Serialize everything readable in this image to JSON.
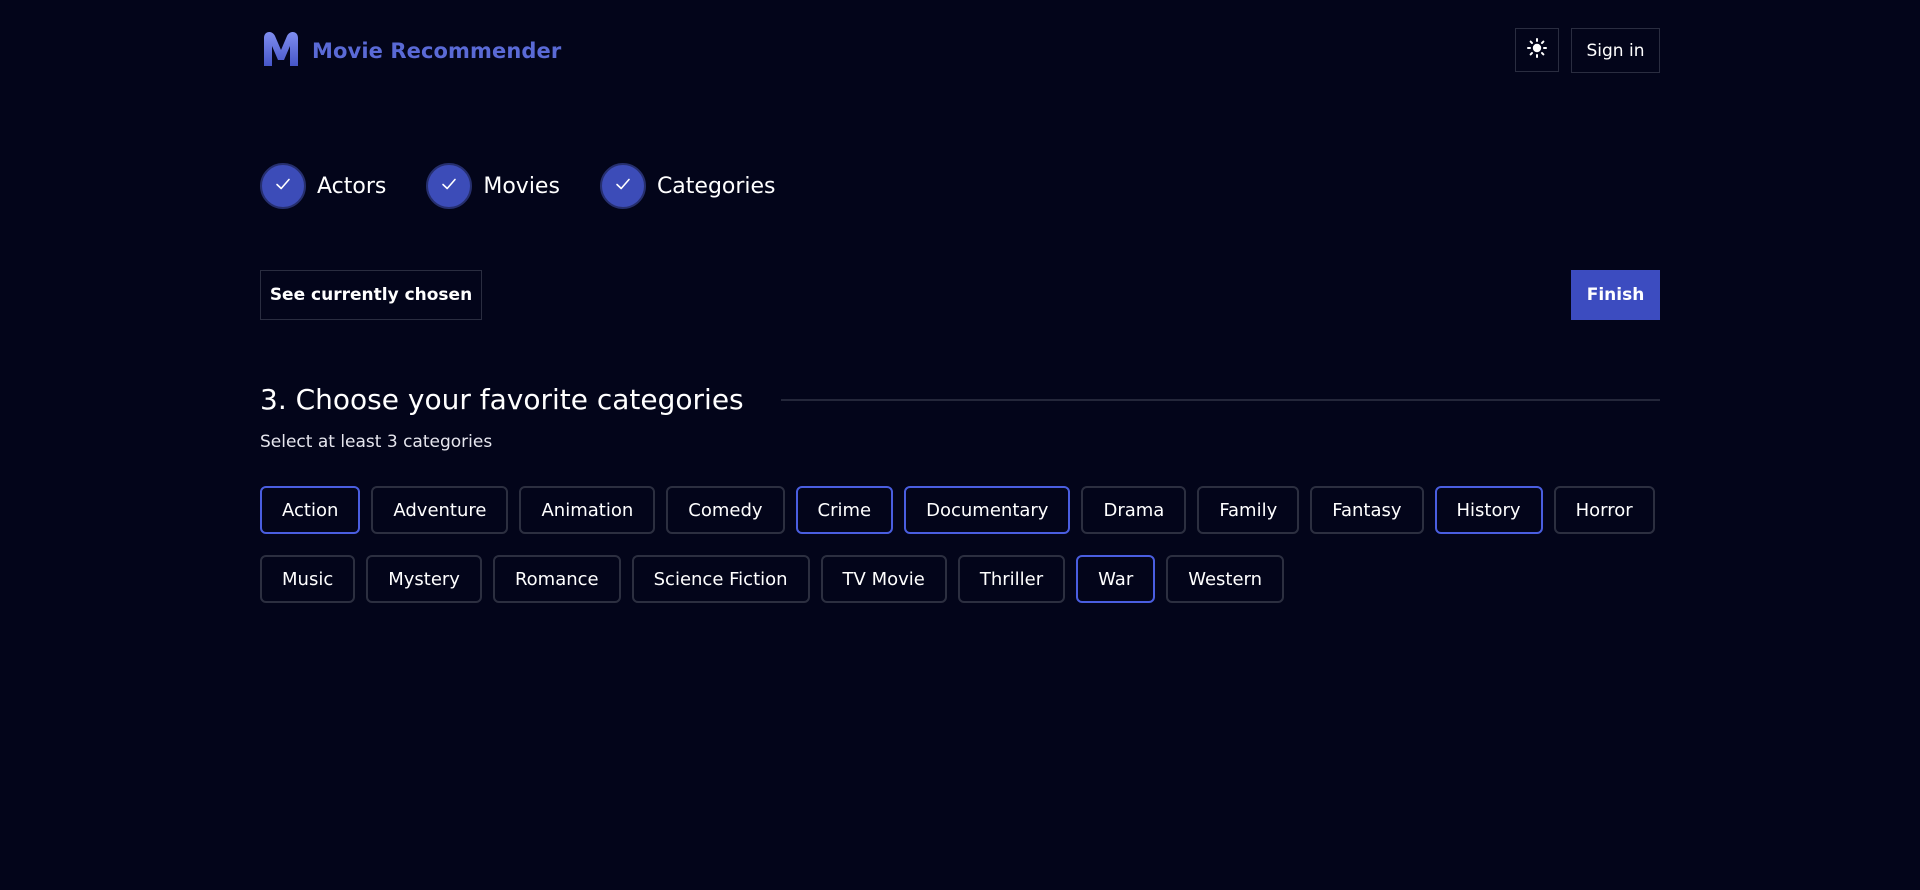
{
  "header": {
    "brand_title": "Movie Recommender",
    "sign_in_label": "Sign in",
    "theme_icon": "sun-icon"
  },
  "colors": {
    "background": "#03051a",
    "accent": "#3c4cc0",
    "brand_text": "#5a6ad6",
    "selected_border": "#4a5ee0",
    "chip_border": "#2c2f40"
  },
  "steps": [
    {
      "label": "Actors",
      "completed": true
    },
    {
      "label": "Movies",
      "completed": true
    },
    {
      "label": "Categories",
      "completed": true
    }
  ],
  "actions": {
    "see_chosen_label": "See currently chosen",
    "finish_label": "Finish"
  },
  "section": {
    "title": "3. Choose your favorite categories",
    "subtitle": "Select at least 3 categories"
  },
  "categories": {
    "row1": [
      {
        "label": "Action",
        "selected": true
      },
      {
        "label": "Adventure",
        "selected": false
      },
      {
        "label": "Animation",
        "selected": false
      },
      {
        "label": "Comedy",
        "selected": false
      },
      {
        "label": "Crime",
        "selected": true
      },
      {
        "label": "Documentary",
        "selected": true
      },
      {
        "label": "Drama",
        "selected": false
      },
      {
        "label": "Family",
        "selected": false
      },
      {
        "label": "Fantasy",
        "selected": false
      },
      {
        "label": "History",
        "selected": true
      },
      {
        "label": "Horror",
        "selected": false
      }
    ],
    "row2": [
      {
        "label": "Music",
        "selected": false
      },
      {
        "label": "Mystery",
        "selected": false
      },
      {
        "label": "Romance",
        "selected": false
      },
      {
        "label": "Science Fiction",
        "selected": false
      },
      {
        "label": "TV Movie",
        "selected": false
      },
      {
        "label": "Thriller",
        "selected": false
      },
      {
        "label": "War",
        "selected": true
      },
      {
        "label": "Western",
        "selected": false
      }
    ]
  }
}
